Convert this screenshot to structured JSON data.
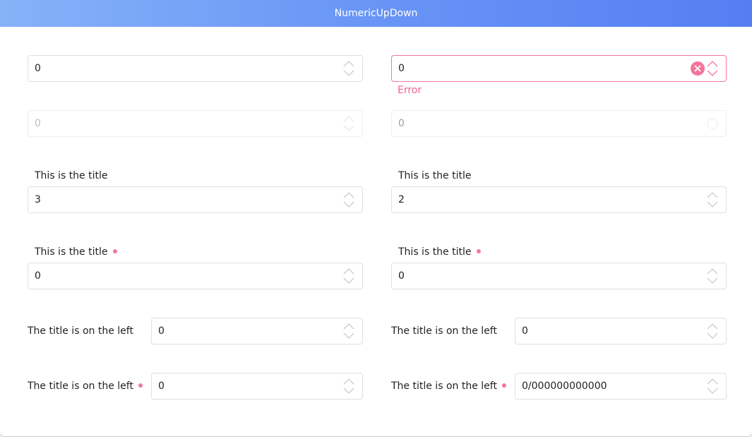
{
  "window": {
    "title": "NumericUpDown"
  },
  "rows": {
    "r1": {
      "left_value": "0",
      "right_value": "0",
      "right_error": "Error"
    },
    "r2": {
      "left_value": "0",
      "right_value": "0"
    },
    "r3": {
      "left_title": "This is the title",
      "left_value": "3",
      "right_title": "This is the title",
      "right_value": "2"
    },
    "r4": {
      "left_title": "This is the title",
      "left_value": "0",
      "right_title": "This is the title",
      "right_value": "0"
    },
    "r5": {
      "left_title": "The title is on the left",
      "left_value": "0",
      "right_title": "The title is on the left",
      "right_value": "0"
    },
    "r6": {
      "left_title": "The title is on the left",
      "left_value": "0",
      "right_title": "The title is on the left",
      "right_value": "0/000000000000"
    }
  },
  "colors": {
    "accent": "#557ef3",
    "error": "#f5769c",
    "border": "#dcdfe6",
    "disabled_text": "#b8bcc4"
  },
  "icons": {
    "spinner": "chevron-up-down-icon",
    "clear": "close-circle-icon",
    "required": "required-dot-icon"
  }
}
